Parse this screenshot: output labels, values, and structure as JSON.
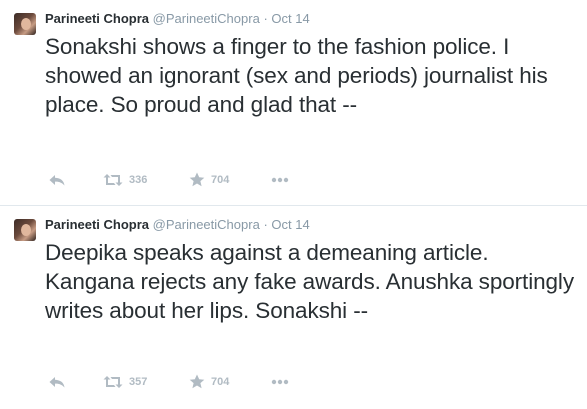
{
  "tweets": [
    {
      "name": "Parineeti Chopra",
      "handle": "@ParineetiChopra",
      "separator": "·",
      "time": "Oct 14",
      "text": "Sonakshi shows a finger to the fashion police. I showed an ignorant (sex and periods) journalist his place. So proud and glad that --",
      "retweets": "336",
      "favorites": "704"
    },
    {
      "name": "Parineeti Chopra",
      "handle": "@ParineetiChopra",
      "separator": "·",
      "time": "Oct 14",
      "text": "Deepika speaks against a demeaning article. Kangana rejects any fake awards. Anushka sportingly writes about her lips. Sonakshi --",
      "retweets": "357",
      "favorites": "704"
    }
  ],
  "icons": {
    "reply": "reply-icon",
    "retweet": "retweet-icon",
    "favorite": "star-icon",
    "more": "more-dots-icon"
  },
  "colors": {
    "text": "#292f33",
    "muted": "#8899a6",
    "action": "#b1bbc3",
    "divider": "#e1e8ed"
  }
}
